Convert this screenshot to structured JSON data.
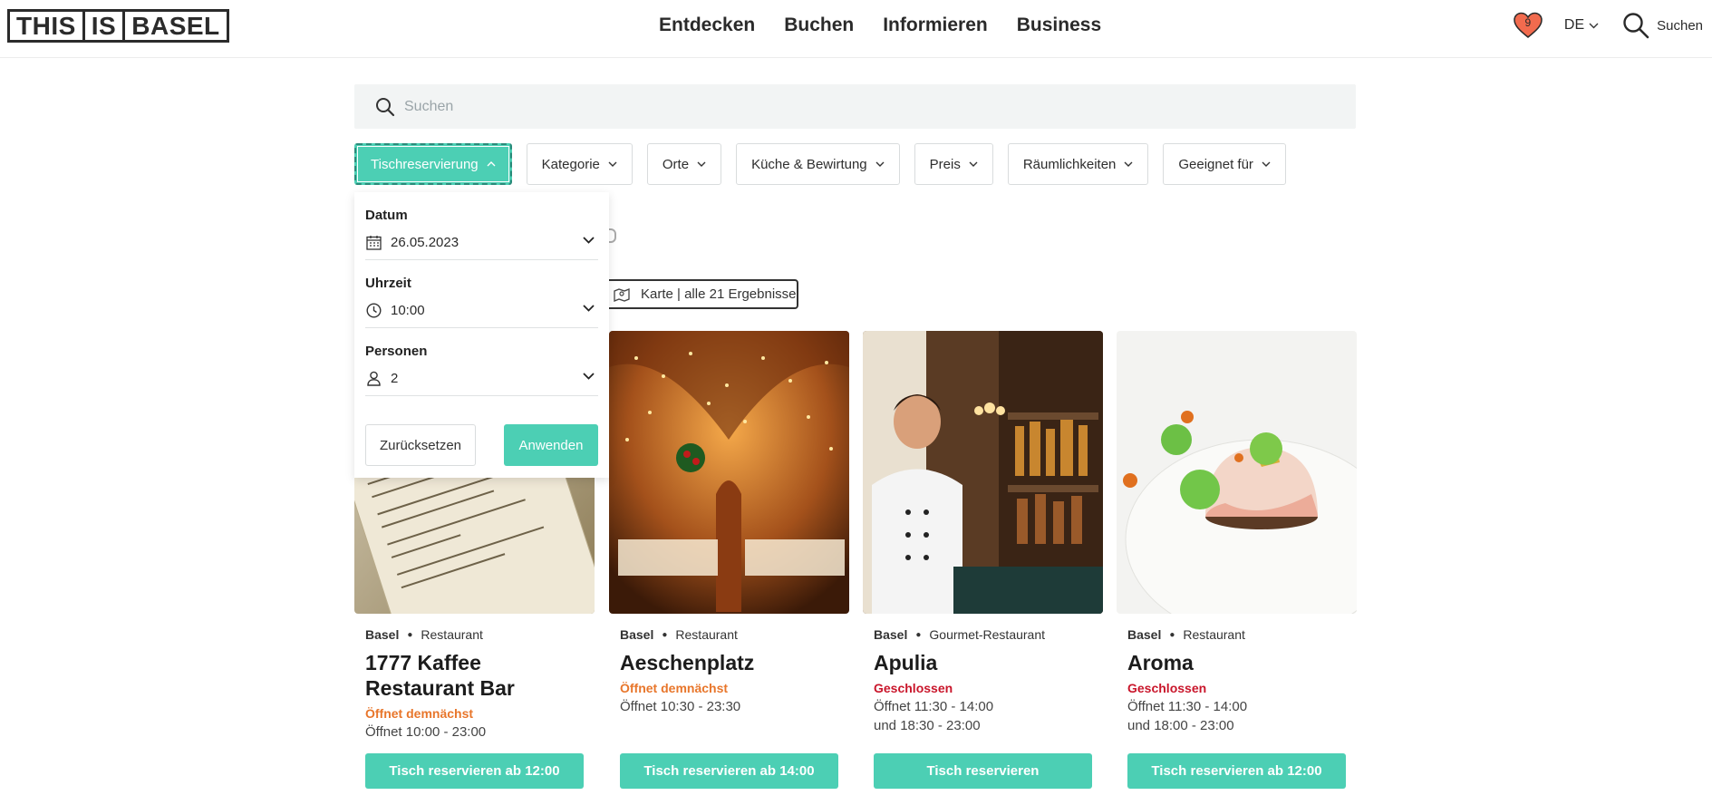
{
  "header": {
    "logo": [
      "THIS",
      "IS",
      "BASEL"
    ],
    "nav": [
      "Entdecken",
      "Buchen",
      "Informieren",
      "Business"
    ],
    "favorites_count": "9",
    "language": "DE",
    "search_label": "Suchen"
  },
  "search": {
    "placeholder": "Suchen"
  },
  "filters": [
    {
      "label": "Tischreservierung",
      "active": true
    },
    {
      "label": "Kategorie"
    },
    {
      "label": "Orte"
    },
    {
      "label": "Küche & Bewirtung"
    },
    {
      "label": "Preis"
    },
    {
      "label": "Räumlichkeiten"
    },
    {
      "label": "Geeignet für"
    }
  ],
  "reservation_panel": {
    "date_label": "Datum",
    "date_value": "26.05.2023",
    "time_label": "Uhrzeit",
    "time_value": "10:00",
    "persons_label": "Personen",
    "persons_value": "2",
    "reset_label": "Zurücksetzen",
    "apply_label": "Anwenden"
  },
  "map_button": {
    "label": "Karte | alle 21 Ergebnisse"
  },
  "results": [
    {
      "city": "Basel",
      "category": "Restaurant",
      "name": "1777 Kaffee Restaurant Bar",
      "status": "Öffnet demnächst",
      "status_type": "soon",
      "hours": [
        "Öffnet 10:00 - 23:00"
      ],
      "button": "Tisch reservieren ab 12:00",
      "image": "menu-cards-photo"
    },
    {
      "city": "Basel",
      "category": "Restaurant",
      "name": "Aeschenplatz",
      "status": "Öffnet demnächst",
      "status_type": "soon",
      "hours": [
        "Öffnet 10:30 - 23:30"
      ],
      "button": "Tisch reservieren ab 14:00",
      "image": "vaulted-cellar-dining-photo"
    },
    {
      "city": "Basel",
      "category": "Gourmet-Restaurant",
      "name": "Apulia",
      "status": "Geschlossen",
      "status_type": "closed",
      "hours": [
        "Öffnet 11:30 - 14:00",
        "und 18:30 - 23:00"
      ],
      "button": "Tisch reservieren",
      "image": "chef-at-bar-photo"
    },
    {
      "city": "Basel",
      "category": "Restaurant",
      "name": "Aroma",
      "status": "Geschlossen",
      "status_type": "closed",
      "hours": [
        "Öffnet 11:30 - 14:00",
        "und 18:00 - 23:00"
      ],
      "button": "Tisch reservieren ab 12:00",
      "image": "dessert-dome-photo"
    }
  ],
  "colors": {
    "accent": "#4ccfb4",
    "status_soon": "#e8762b",
    "status_closed": "#c9162b",
    "heart": "#f26b4e"
  }
}
